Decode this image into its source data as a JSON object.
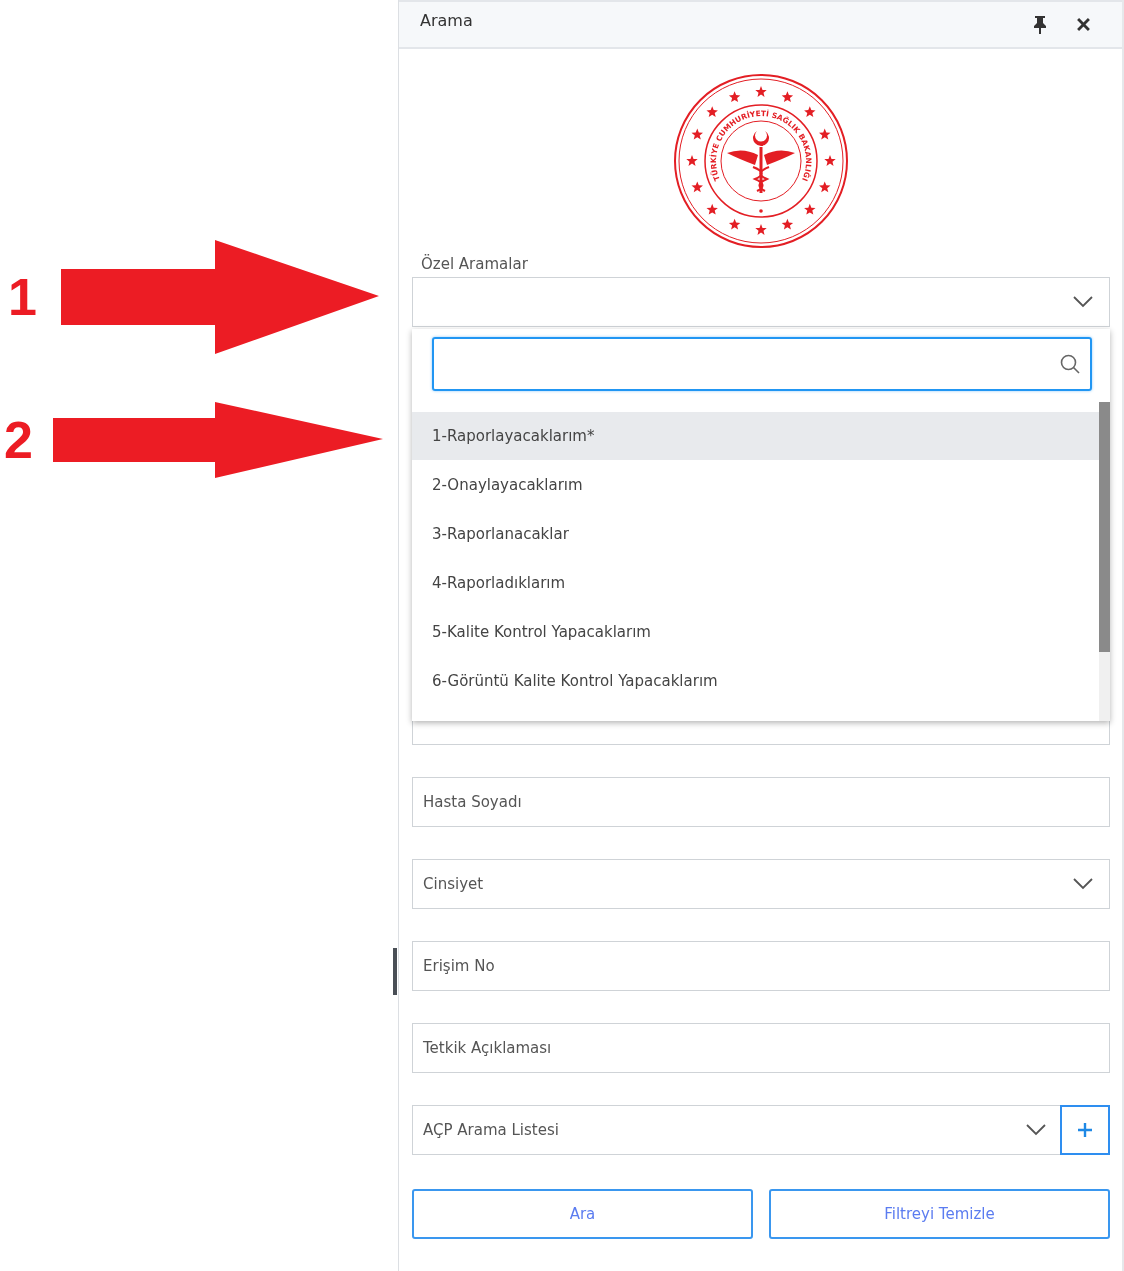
{
  "annotations": [
    {
      "label": "1"
    },
    {
      "label": "2"
    }
  ],
  "panel": {
    "title": "Arama",
    "pinned": true
  },
  "emblem": {
    "text": "TÜRKİYE CUMHURİYETİ SAĞLIK BAKANLIĞI"
  },
  "special_searches": {
    "label": "Özel Aramalar",
    "expanded": true,
    "options": [
      {
        "label": "1-Raporlayacaklarım*",
        "selected": true
      },
      {
        "label": "2-Onaylayacaklarım",
        "selected": false
      },
      {
        "label": "3-Raporlanacaklar",
        "selected": false
      },
      {
        "label": "4-Raporladıklarım",
        "selected": false
      },
      {
        "label": "5-Kalite Kontrol Yapacaklarım",
        "selected": false
      },
      {
        "label": "6-Görüntü Kalite Kontrol Yapacaklarım",
        "selected": false
      }
    ]
  },
  "fields": [
    {
      "kind": "text"
    },
    {
      "kind": "text",
      "placeholder": "Hasta Soyadı"
    },
    {
      "kind": "select",
      "placeholder": "Cinsiyet"
    },
    {
      "kind": "text",
      "placeholder": "Erişim No"
    },
    {
      "kind": "text",
      "placeholder": "Tetkik Açıklaması"
    },
    {
      "kind": "select_add",
      "placeholder": "AÇP Arama Listesi"
    }
  ],
  "buttons": [
    "Ara",
    "Filtreyi Temizle"
  ]
}
